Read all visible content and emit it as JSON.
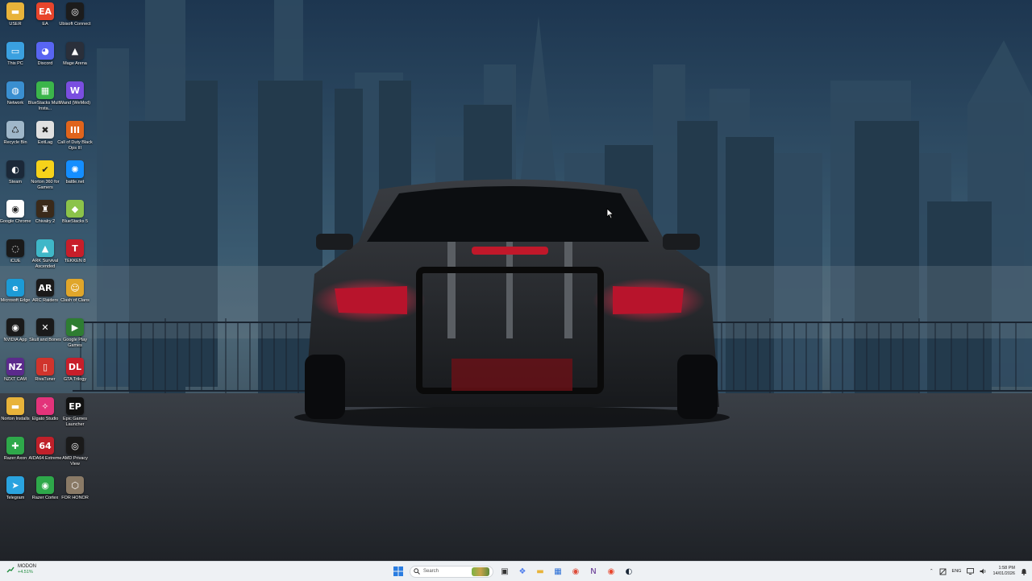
{
  "desktop": {
    "icons": [
      {
        "label": "USER",
        "icon": "folder-icon",
        "color": "#e8b33a",
        "glyph": "▬"
      },
      {
        "label": "EA",
        "icon": "ea-icon",
        "color": "#e8452c",
        "glyph": "EA"
      },
      {
        "label": "Ubisoft Connect",
        "icon": "ubisoft-icon",
        "color": "#1c1c1c",
        "glyph": "◎"
      },
      {
        "label": "This PC",
        "icon": "this-pc-icon",
        "color": "#3aa0e0",
        "glyph": "▭"
      },
      {
        "label": "Discord",
        "icon": "discord-icon",
        "color": "#5865f2",
        "glyph": "◕"
      },
      {
        "label": "Mage Arena",
        "icon": "mage-arena-icon",
        "color": "#2a2f3a",
        "glyph": "▲"
      },
      {
        "label": "Network",
        "icon": "network-icon",
        "color": "#3a8fd0",
        "glyph": "◍"
      },
      {
        "label": "BlueStacks Multi-Insta...",
        "icon": "bluestacks-multi-icon",
        "color": "#3bb54a",
        "glyph": "▦"
      },
      {
        "label": "Wand (WeMod)",
        "icon": "wand-icon",
        "color": "#7a4ee0",
        "glyph": "W"
      },
      {
        "label": "Recycle Bin",
        "icon": "recycle-bin-icon",
        "color": "#9fb7c9",
        "glyph": "♺"
      },
      {
        "label": "ExitLag",
        "icon": "exitlag-icon",
        "color": "#e0e0e0",
        "glyph": "✖"
      },
      {
        "label": "Call of Duty Black Ops III",
        "icon": "call-of-duty-icon",
        "color": "#e0641c",
        "glyph": "III"
      },
      {
        "label": "Steam",
        "icon": "steam-icon",
        "color": "#1b2838",
        "glyph": "◐"
      },
      {
        "label": "Norton 360 for Gamers",
        "icon": "norton-icon",
        "color": "#f6d21a",
        "glyph": "✔"
      },
      {
        "label": "battle.net",
        "icon": "battlenet-icon",
        "color": "#148eff",
        "glyph": "✺"
      },
      {
        "label": "Google Chrome",
        "icon": "chrome-icon",
        "color": "#ffffff",
        "glyph": "◉"
      },
      {
        "label": "Chivalry 2",
        "icon": "chivalry-icon",
        "color": "#3a2a1a",
        "glyph": "♜"
      },
      {
        "label": "BlueStacks 5",
        "icon": "bluestacks-icon",
        "color": "#8bc34a",
        "glyph": "◆"
      },
      {
        "label": "iCUE",
        "icon": "icue-icon",
        "color": "#1a1a1a",
        "glyph": "◌"
      },
      {
        "label": "ARK Survival Ascended",
        "icon": "ark-icon",
        "color": "#3fb7c8",
        "glyph": "▲"
      },
      {
        "label": "TEKKEN 8",
        "icon": "tekken-icon",
        "color": "#c81e2a",
        "glyph": "T"
      },
      {
        "label": "Microsoft Edge",
        "icon": "edge-icon",
        "color": "#1c9bd6",
        "glyph": "e"
      },
      {
        "label": "ARC Raiders",
        "icon": "arc-raiders-icon",
        "color": "#1a1a1a",
        "glyph": "AR"
      },
      {
        "label": "Clash of Clans",
        "icon": "clash-of-clans-icon",
        "color": "#e0a62a",
        "glyph": "☺"
      },
      {
        "label": "NVIDIA App",
        "icon": "nvidia-icon",
        "color": "#1a1a1a",
        "glyph": "◉"
      },
      {
        "label": "Skull and Bones",
        "icon": "skull-and-bones-icon",
        "color": "#1a1a1a",
        "glyph": "✕"
      },
      {
        "label": "Google Play Games",
        "icon": "google-play-games-icon",
        "color": "#2e7d32",
        "glyph": "▶"
      },
      {
        "label": "NZXT CAM",
        "icon": "nzxt-icon",
        "color": "#5b2a8c",
        "glyph": "NZ"
      },
      {
        "label": "RivaTuner",
        "icon": "rivatuner-icon",
        "color": "#d0342c",
        "glyph": "▯"
      },
      {
        "label": "GTA Trilogy",
        "icon": "dlc-icon",
        "color": "#c81e2a",
        "glyph": "DL"
      },
      {
        "label": "Norton Installs",
        "icon": "folder-icon",
        "color": "#e8b33a",
        "glyph": "▬"
      },
      {
        "label": "Elgato Studio",
        "icon": "elgato-icon",
        "color": "#e3337a",
        "glyph": "✧"
      },
      {
        "label": "Epic Games Launcher",
        "icon": "epic-games-icon",
        "color": "#111111",
        "glyph": "EP"
      },
      {
        "label": "Razer Axon",
        "icon": "razer-axon-icon",
        "color": "#2ea84a",
        "glyph": "✚"
      },
      {
        "label": "AIDA64 Extreme",
        "icon": "aida64-icon",
        "color": "#c0202a",
        "glyph": "64"
      },
      {
        "label": "AMD Privacy View",
        "icon": "amd-privacy-icon",
        "color": "#1a1a1a",
        "glyph": "◎"
      },
      {
        "label": "Telegram",
        "icon": "telegram-icon",
        "color": "#2aa3df",
        "glyph": "➤"
      },
      {
        "label": "Razer Cortex",
        "icon": "razer-cortex-icon",
        "color": "#2ea84a",
        "glyph": "◉"
      },
      {
        "label": "FOR HONOR",
        "icon": "for-honor-icon",
        "color": "#8a7a66",
        "glyph": "⬡"
      }
    ]
  },
  "taskbar": {
    "weather": {
      "title": "MODON",
      "subtitle": "+4.51%",
      "icon": "stocks-icon",
      "color": "#1b8a3a"
    },
    "start_icon": "windows-start-icon",
    "search": {
      "placeholder": "Search"
    },
    "pinned": [
      {
        "name": "task-view-icon",
        "color": "#333333",
        "glyph": "▣"
      },
      {
        "name": "copilot-icon",
        "color": "#4b7bec",
        "glyph": "❖"
      },
      {
        "name": "file-explorer-icon",
        "color": "#e8b33a",
        "glyph": "▬"
      },
      {
        "name": "microsoft-store-icon",
        "color": "#2a6fd6",
        "glyph": "▦"
      },
      {
        "name": "chrome-icon",
        "color": "#dd4b39",
        "glyph": "◉"
      },
      {
        "name": "nzxt-icon",
        "color": "#5b2a8c",
        "glyph": "N"
      },
      {
        "name": "ea-app-icon",
        "color": "#e8452c",
        "glyph": "◉"
      },
      {
        "name": "steam-icon",
        "color": "#1b2838",
        "glyph": "◐"
      }
    ],
    "tray": {
      "language": "ENG",
      "time": "1:58 PM",
      "date": "14/01/2026"
    }
  }
}
